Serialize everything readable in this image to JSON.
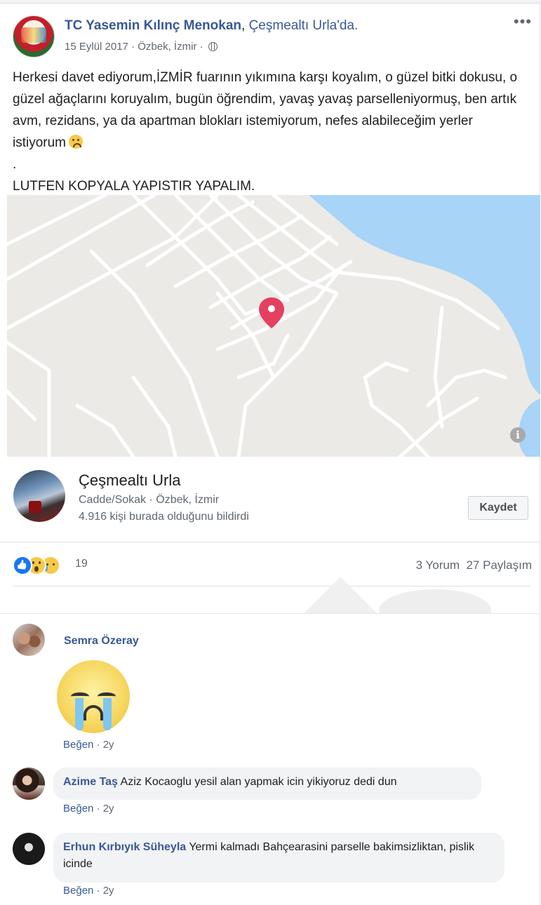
{
  "post": {
    "author": "TC Yasemin Kılınç Menokan",
    "separator": ", ",
    "location": "Çeşmealtı Urla'da.",
    "date": "15 Eylül 2017",
    "place_meta": " · Özbek, İzmir · ",
    "privacy_icon": "globe-icon",
    "more_label": "•••",
    "text_line1": "Herkesi davet ediyorum,İZMİR fuarının yıkımına karşı koyalım, o güzel bitki dokusu, o güzel ağaçlarını koruyalım, bugün öğrendim, yavaş yavaş parselleniyormuş, ben artık avm, rezidans, ya da apartman blokları istemiyorum, nefes alabileceğim yerler istiyorum",
    "text_dot": ".",
    "text_line2": "LUTFEN KOPYALA YAPISTIR YAPALIM."
  },
  "map": {
    "info_label": "i",
    "pin_color": "#e4405f",
    "water_color": "#a8d4f7",
    "land_color": "#ebeae6"
  },
  "place": {
    "name": "Çeşmealtı Urla",
    "type": "Cadde/Sokak · Özbek, İzmir",
    "checkins": "4.916 kişi burada olduğunu bildirdi",
    "save_label": "Kaydet"
  },
  "reactions": {
    "icons": [
      "like-icon",
      "wow-icon",
      "sad-icon"
    ],
    "count": "19",
    "comments": "3 Yorum",
    "shares": "27 Paylaşım"
  },
  "comments": [
    {
      "name": "Semra Özeray",
      "text": "",
      "sticker": "crying-face-sticker",
      "like": "Beğen",
      "time": " · 2y"
    },
    {
      "name": "Azime Taş",
      "text": " Aziz Kocaoglu yesil alan yapmak icin yikiyoruz dedi dun",
      "like": "Beğen",
      "time": " · 2y"
    },
    {
      "name": "Erhun Kırbıyık Süheyla",
      "text": " Yermi kalmadı Bahçearasini parselle bakimsizliktan, pislik icinde",
      "like": "Beğen",
      "time": " · 2y"
    }
  ],
  "colors": {
    "link": "#385898",
    "secondary_text": "#606770",
    "like_blue": "#1877f2"
  }
}
